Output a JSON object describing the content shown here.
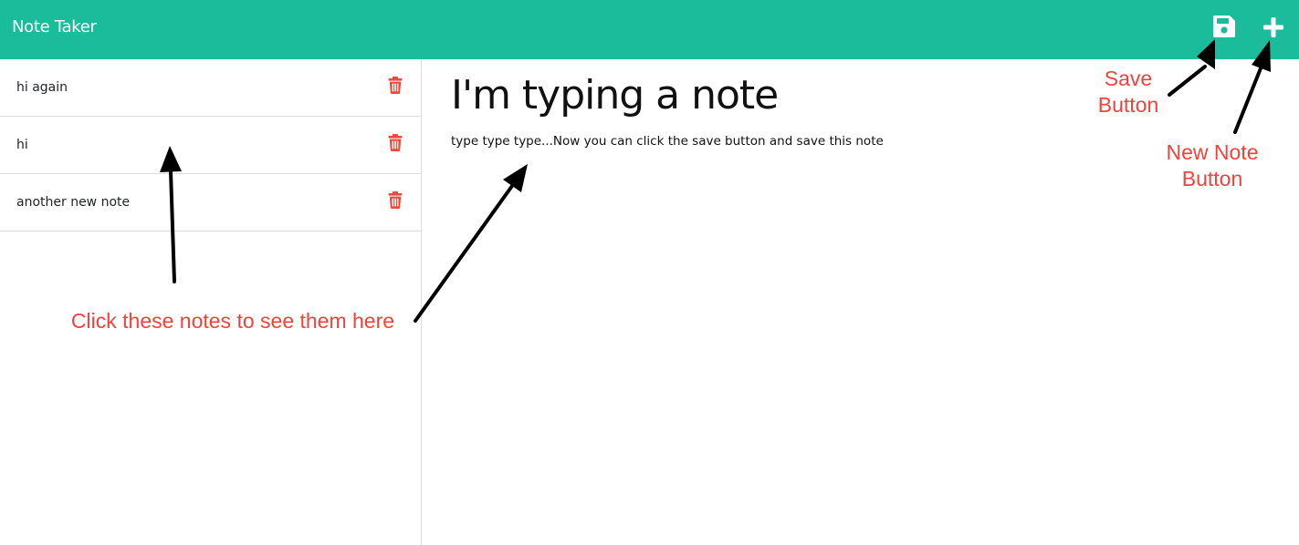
{
  "navbar": {
    "brand": "Note Taker",
    "save_icon": "save-icon",
    "add_icon": "plus-icon",
    "background": "#1abc9c"
  },
  "notes": [
    {
      "title": "hi again"
    },
    {
      "title": "hi"
    },
    {
      "title": "another new note"
    }
  ],
  "editor": {
    "title": "I'm typing a note",
    "body": "type type type...Now you can click the save button and save this note"
  },
  "annotations": {
    "save": [
      "Save",
      "Button"
    ],
    "new_note": [
      "New Note",
      "Button"
    ],
    "notes_hint": "Click these notes to see them here"
  },
  "colors": {
    "delete": "#e74c3c",
    "annotation": "#f2423c"
  }
}
